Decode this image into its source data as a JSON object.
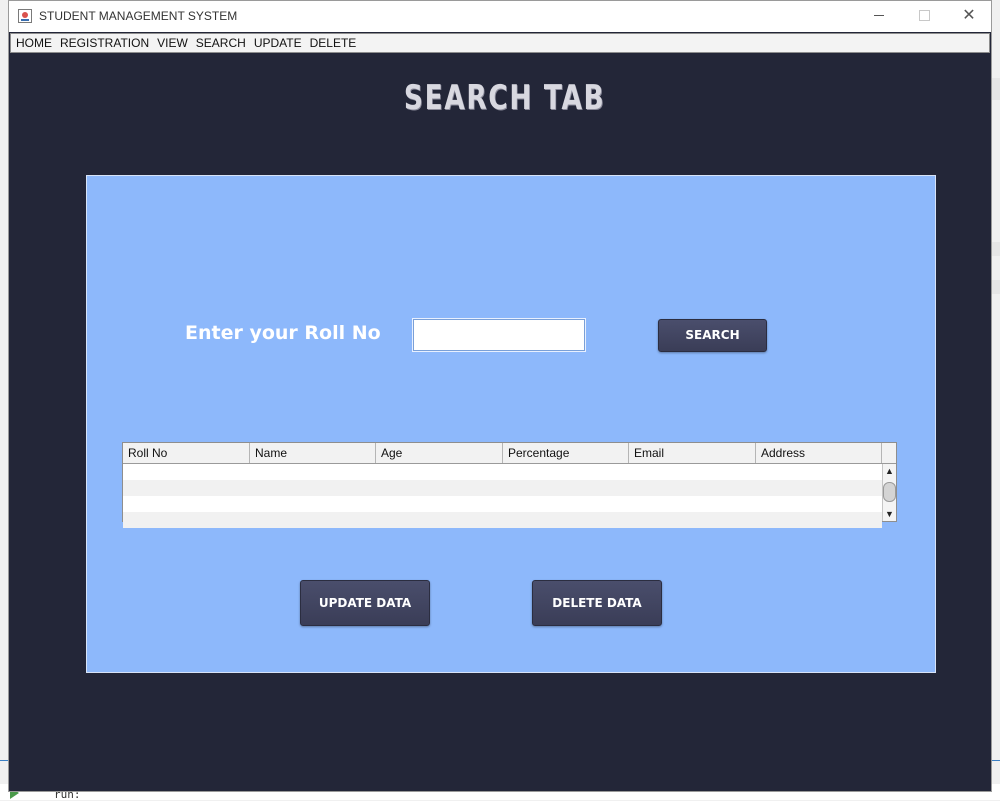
{
  "window": {
    "title": "STUDENT MANAGEMENT SYSTEM"
  },
  "menu": [
    "HOME",
    "REGISTRATION",
    "VIEW",
    "SEARCH",
    "UPDATE",
    "DELETE"
  ],
  "heading": "SEARCH TAB",
  "form": {
    "roll_label": "Enter your Roll No",
    "roll_value": "",
    "search_label": "SEARCH"
  },
  "table": {
    "columns": [
      "Roll No",
      "Name",
      "Age",
      "Percentage",
      "Email",
      "Address"
    ],
    "rows": []
  },
  "actions": {
    "update_label": "UPDATE DATA",
    "delete_label": "DELETE DATA"
  },
  "console": {
    "text": "run:"
  },
  "colors": {
    "window_bg": "#232638",
    "panel_bg": "#8db8fb",
    "button_bg": "#3f4360"
  }
}
